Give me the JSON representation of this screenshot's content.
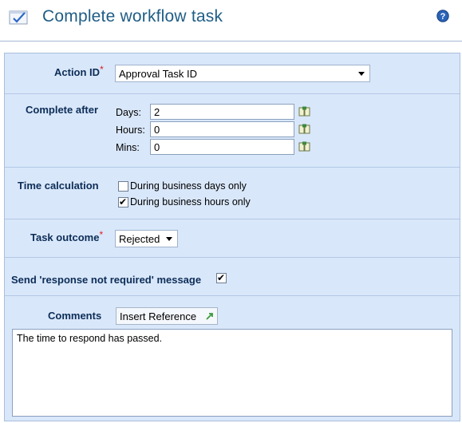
{
  "header": {
    "title": "Complete workflow task",
    "icon": "checklist-icon",
    "help_icon": "help-icon"
  },
  "form": {
    "action_id": {
      "label": "Action ID",
      "required": "*",
      "value": "Approval Task ID"
    },
    "complete_after": {
      "label": "Complete after",
      "days": {
        "label": "Days:",
        "value": "2"
      },
      "hours": {
        "label": "Hours:",
        "value": "0"
      },
      "mins": {
        "label": "Mins:",
        "value": "0"
      },
      "picker_icon": "reference-picker-icon"
    },
    "time_calculation": {
      "label": "Time calculation",
      "options": [
        {
          "label": "During business days only",
          "checked": false
        },
        {
          "label": "During business hours only",
          "checked": true
        }
      ]
    },
    "task_outcome": {
      "label": "Task outcome",
      "required": "*",
      "value": "Rejected"
    },
    "send_message": {
      "label": "Send 'response not required' message",
      "checked": true
    },
    "comments": {
      "label": "Comments",
      "insert_button": "Insert Reference",
      "value": "The time to respond has passed."
    }
  },
  "colors": {
    "title": "#1f5d86",
    "label": "#0c2d57",
    "panel": "#d9e7fa",
    "required": "#dd2222"
  }
}
